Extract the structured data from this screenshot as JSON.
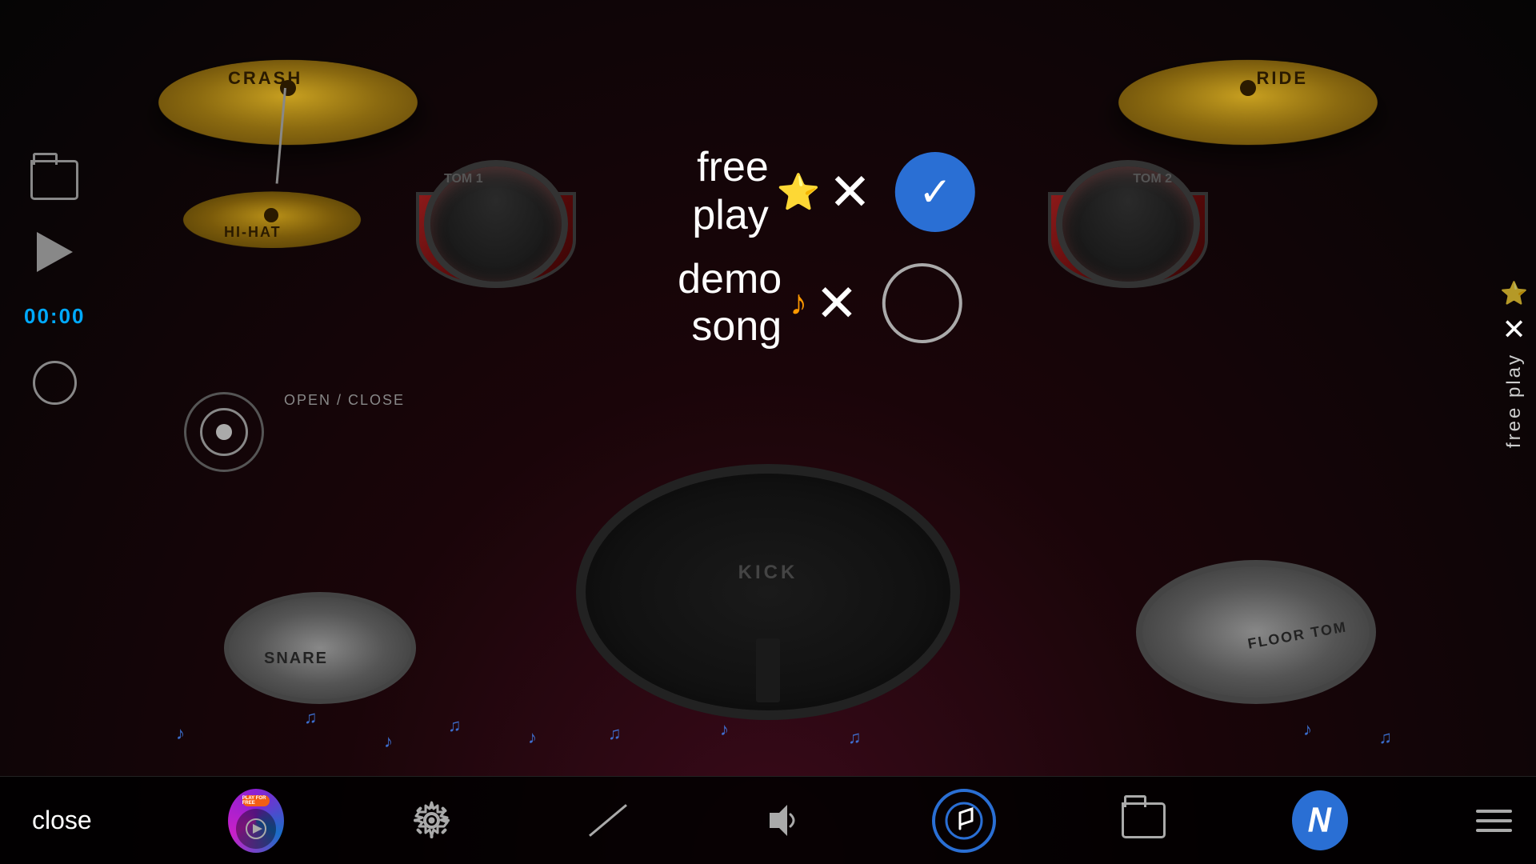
{
  "background": {
    "color": "#0a0a0a"
  },
  "drums": {
    "crash_label": "CRASH",
    "ride_label": "RIDE",
    "hihat_label": "HI-HAT",
    "tom1_label": "TOM 1",
    "tom2_label": "TOM 2",
    "kick_label": "KICK",
    "snare_label": "SNARE",
    "floor_tom_label": "FLOOR TOM",
    "open_close_label": "OPEN / CLOSE"
  },
  "mode_overlay": {
    "free_play_label": "free\nplay",
    "free_play_icon": "⭐",
    "free_play_x": "✕",
    "demo_song_label": "demo\nsong",
    "demo_song_icon": "♪",
    "demo_song_x": "✕",
    "free_play_selected": true,
    "demo_song_selected": false
  },
  "right_edge": {
    "star_icon": "⭐",
    "x_icon": "✕",
    "text": "free play"
  },
  "left_controls": {
    "timer": "00:00"
  },
  "bottom_toolbar": {
    "close_label": "close",
    "play_for_free_badge": "PLAY FOR FREE",
    "gear_icon": "gear",
    "stick_icon": "stick",
    "speaker_icon": "speaker",
    "music_note_icon": "music-note",
    "folder_icon": "folder",
    "n_letter": "𝒩",
    "hamburger_icon": "menu"
  },
  "music_notes": [
    "♪",
    "♫",
    "♪",
    "♫",
    "♪",
    "♫",
    "♪",
    "♫",
    "♪"
  ]
}
